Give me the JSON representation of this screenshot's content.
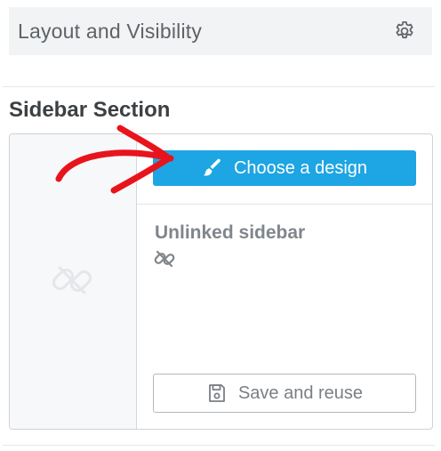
{
  "header": {
    "title": "Layout and Visibility",
    "settings_icon": "gear-icon"
  },
  "section": {
    "title": "Sidebar Section",
    "choose_design_label": "Choose a design",
    "choose_design_icon": "brush-icon",
    "status_label": "Unlinked sidebar",
    "status_icon": "unlink-icon",
    "save_label": "Save and reuse",
    "save_icon": "save-icon"
  },
  "colors": {
    "accent": "#1ea5e3",
    "annotation": "#e8141c",
    "header_bg": "#f1f3f4"
  }
}
